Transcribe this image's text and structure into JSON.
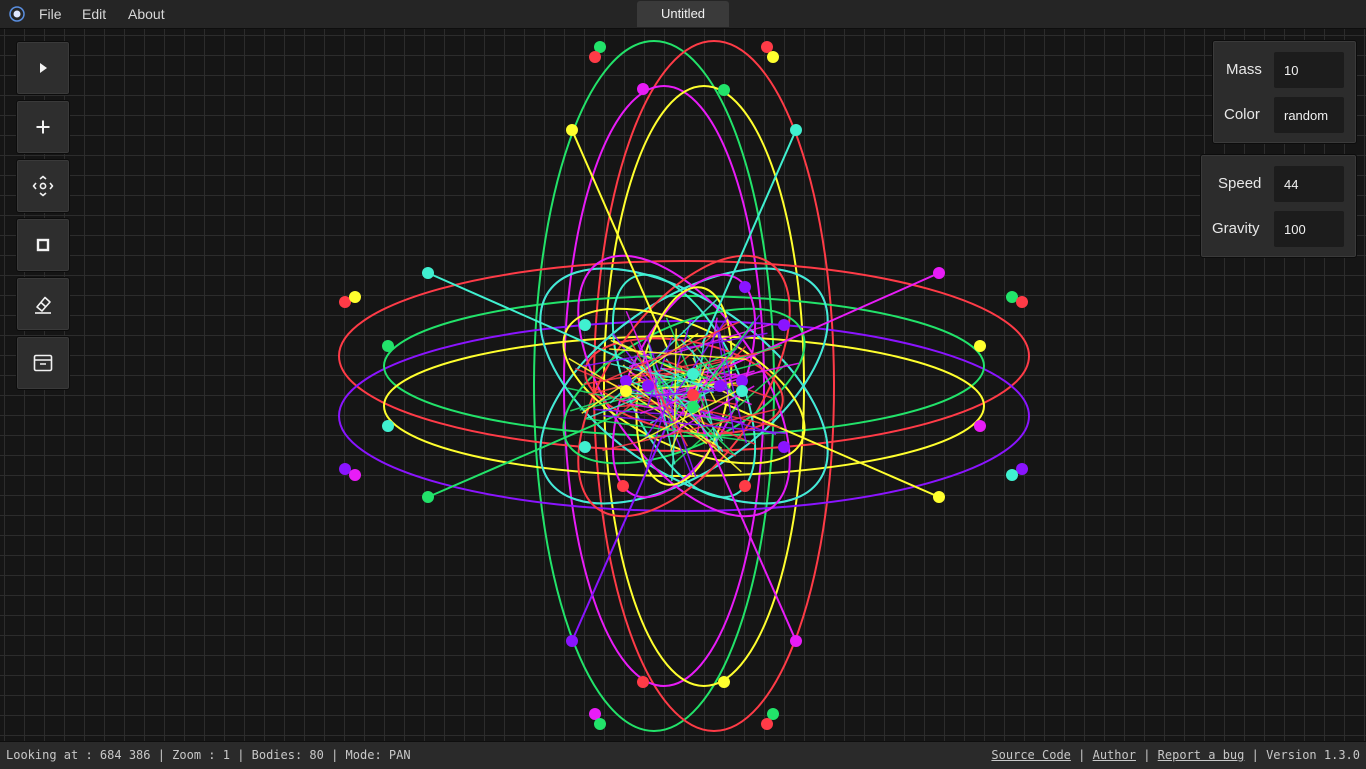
{
  "menubar": {
    "items": [
      "File",
      "Edit",
      "About"
    ],
    "document_tab": "Untitled"
  },
  "toolbar": {
    "buttons": [
      {
        "name": "play-icon"
      },
      {
        "name": "plus-icon"
      },
      {
        "name": "move-icon"
      },
      {
        "name": "stop-icon"
      },
      {
        "name": "eraser-icon"
      },
      {
        "name": "archive-icon"
      }
    ]
  },
  "body_panel": {
    "mass_label": "Mass",
    "mass_value": "10",
    "color_label": "Color",
    "color_value": "random"
  },
  "sim_panel": {
    "speed_label": "Speed",
    "speed_value": "44",
    "gravity_label": "Gravity",
    "gravity_value": "100"
  },
  "statusbar": {
    "info": "Looking at : 684 386 | Zoom : 1 | Bodies: 80 | Mode: PAN",
    "source_code": "Source Code",
    "author": "Author",
    "report_bug": "Report a bug",
    "version": "Version 1.3.0"
  },
  "colors": {
    "green": "#22e36a",
    "red": "#ff3b47",
    "yellow": "#ffff2e",
    "magenta": "#e81cf7",
    "cyan": "#40f0d0",
    "violet": "#8a14ff"
  }
}
